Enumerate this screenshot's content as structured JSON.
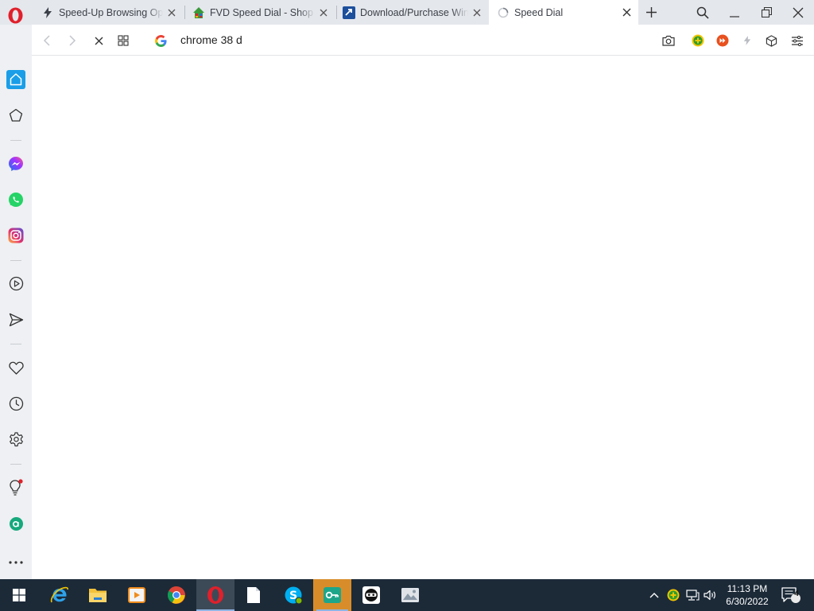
{
  "browser": {
    "tabs": [
      {
        "title": "Speed-Up Browsing Options",
        "icon": "lightning-icon",
        "active": false
      },
      {
        "title": "FVD Speed Dial - Shop & Apps",
        "icon": "fvd-house-icon",
        "active": false
      },
      {
        "title": "Download/Purchase Windows",
        "icon": "download-site-icon",
        "active": false
      },
      {
        "title": "Speed Dial",
        "icon": "loading-spinner-icon",
        "active": true
      }
    ],
    "address_bar": {
      "value": "chrome 38 d",
      "search_engine_icon": "google-icon"
    }
  },
  "sidebar": {
    "items": [
      "home-icon",
      "bookmarks-icon",
      "messenger-icon",
      "whatsapp-icon",
      "instagram-icon",
      "player-icon",
      "send-icon",
      "heart-icon",
      "history-icon",
      "settings-icon",
      "lightbulb-icon",
      "aria-icon",
      "more-icon"
    ]
  },
  "taskbar": {
    "apps": [
      "windows-start-icon",
      "internet-explorer-icon",
      "file-explorer-icon",
      "media-player-icon",
      "chrome-icon",
      "opera-icon",
      "notepad-icon",
      "skype-icon",
      "vpn-key-icon",
      "ninja-app-icon",
      "photos-icon"
    ],
    "clock": {
      "time": "11:13 PM",
      "date": "6/30/2022"
    },
    "notification_count": "4"
  },
  "colors": {
    "opera_red": "#e0202b",
    "sidebar_accent": "#1a9ee8",
    "taskbar_bg": "#1c2a38",
    "tab_strip_bg": "#e4e7ec"
  }
}
